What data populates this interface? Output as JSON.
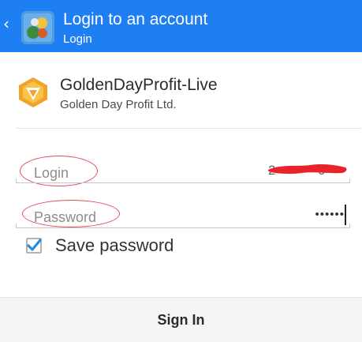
{
  "appbar": {
    "title": "Login to an account",
    "subtitle": "Login",
    "back_icon": "chevron-left-icon",
    "app_icon": "metatrader-app-icon",
    "background": "#1e7ff3"
  },
  "broker": {
    "name": "GoldenDayProfit-Live",
    "company": "Golden Day Profit Ltd.",
    "logo_icon": "golden-day-profit-logo-icon"
  },
  "form": {
    "login_label": "Login",
    "login_value_redacted": true,
    "password_label": "Password",
    "password_value": "••••••",
    "save_password_label": "Save password",
    "save_password_checked": true,
    "annotation_color": "#e04e59",
    "checkbox_color": "#2a8bd9"
  },
  "footer": {
    "signin_label": "Sign In"
  }
}
